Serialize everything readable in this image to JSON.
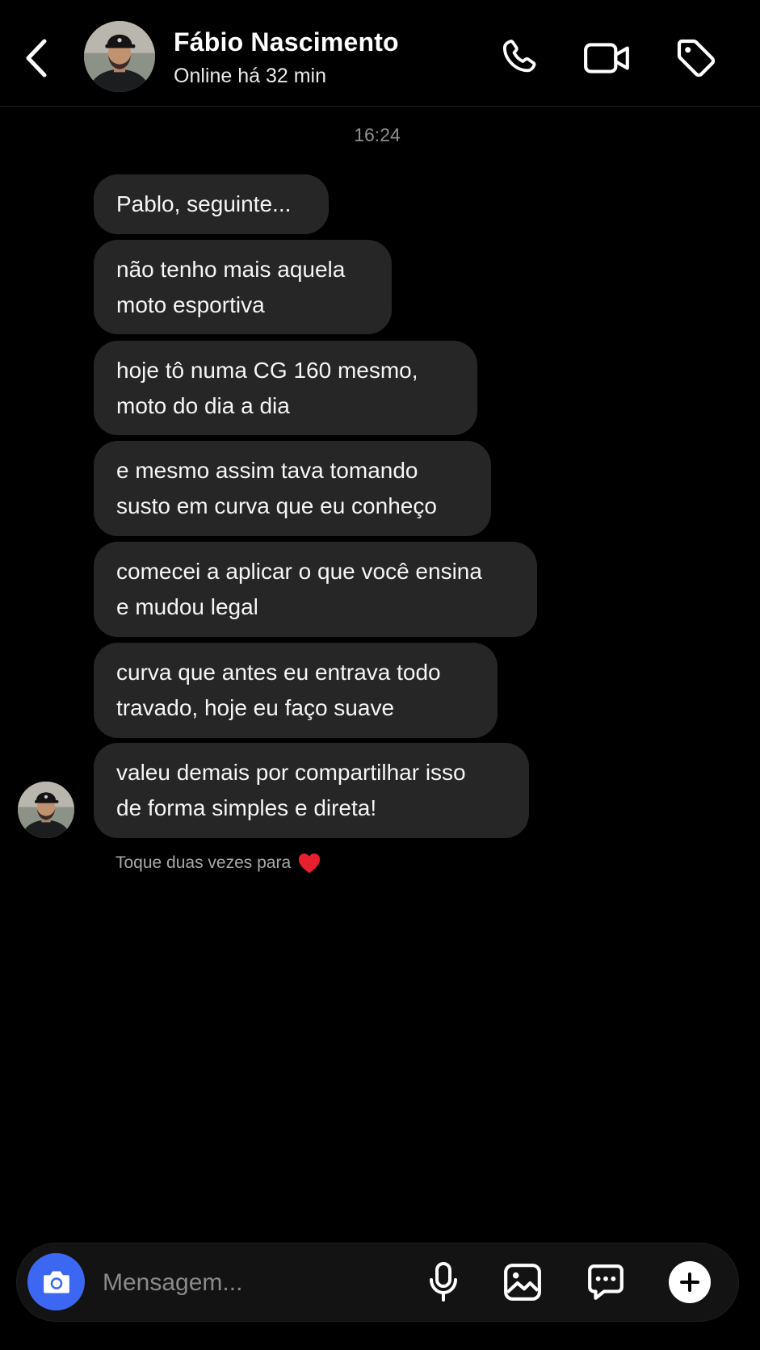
{
  "header": {
    "contact_name": "Fábio Nascimento",
    "status": "Online há 32 min",
    "icons": {
      "back": "chevron-left-icon",
      "call": "phone-icon",
      "video": "video-camera-icon",
      "tag": "tag-icon"
    }
  },
  "conversation": {
    "timestamp": "16:24",
    "messages": [
      {
        "text": "Pablo, seguinte..."
      },
      {
        "text": "não tenho mais aquela\nmoto esportiva"
      },
      {
        "text": "hoje tô numa CG 160 mesmo,\nmoto do dia a dia"
      },
      {
        "text": "e mesmo assim tava tomando\nsusto em curva que eu conheço"
      },
      {
        "text": "comecei a aplicar o que você ensina\ne mudou legal"
      },
      {
        "text": "curva que antes eu entrava todo\ntravado, hoje eu faço suave"
      },
      {
        "text": "valeu demais por compartilhar isso\nde forma simples e direta!"
      }
    ],
    "like_hint": "Toque duas vezes para",
    "like_hint_icon": "heart-icon"
  },
  "composer": {
    "placeholder": "Mensagem...",
    "value": "",
    "icons": {
      "camera": "camera-icon",
      "mic": "microphone-icon",
      "gallery": "image-icon",
      "sticker": "chat-bubble-icon",
      "plus": "plus-icon"
    }
  },
  "colors": {
    "background": "#000000",
    "bubble": "#262626",
    "accent": "#3c67f2",
    "heart": "#e8202e",
    "muted_text": "#8e8e8e"
  }
}
